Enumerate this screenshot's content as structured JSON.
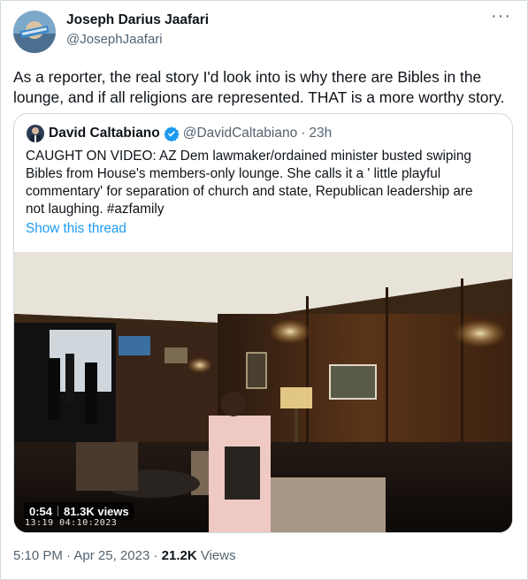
{
  "author": {
    "name": "Joseph Darius Jaafari",
    "handle": "@JosephJaafari"
  },
  "more_icon": "more-horizontal-icon",
  "tweet_text": "As a reporter, the real story I'd look into is why there are Bibles in the lounge, and if all religions are represented. THAT is a more worthy story.",
  "quote": {
    "name": "David Caltabiano",
    "handle": "@DavidCaltabiano",
    "separator": "·",
    "time": "23h",
    "verified_icon": "verified-badge-icon",
    "text": "CAUGHT ON VIDEO: AZ Dem lawmaker/ordained minister busted swiping Bibles from House's members-only lounge. She calls it a ' little playful commentary' for separation of church and state, Republican leadership are not laughing. #azfamily",
    "show_thread": "Show this thread",
    "video": {
      "duration": "0:54",
      "views": "81.3K views",
      "timestamp_overlay": "13:19 04:10:2023"
    }
  },
  "meta": {
    "time": "5:10 PM",
    "separator1": " · ",
    "date": "Apr 25, 2023",
    "separator2": " · ",
    "views_count": "21.2K",
    "views_label": " Views"
  },
  "colors": {
    "link": "#1d9bf0",
    "secondary_text": "#536471",
    "border": "#cfd9de"
  }
}
